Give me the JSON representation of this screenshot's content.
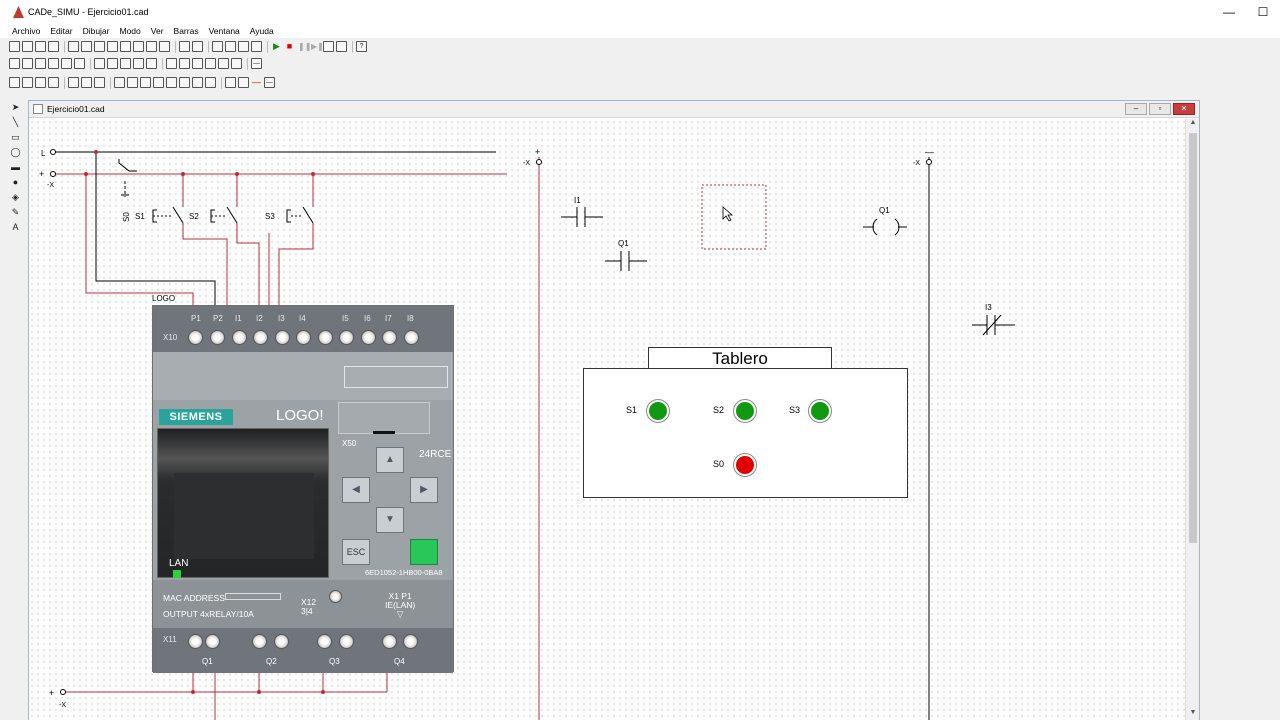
{
  "app": {
    "title": "CADe_SIMU - Ejercicio01.cad"
  },
  "window_controls": {
    "minimize": "—",
    "maximize": "☐"
  },
  "menu": [
    "Archivo",
    "Editar",
    "Dibujar",
    "Modo",
    "Ver",
    "Barras",
    "Ventana",
    "Ayuda"
  ],
  "document": {
    "title": "Ejercicio01.cad"
  },
  "schematic": {
    "rail_labels": {
      "l": "L",
      "plus": "+",
      "minus_x": "-X",
      "x_top": "-X",
      "plus_right": "+",
      "x_right": "-X",
      "minus_right": "—",
      "plus_bottom": "+",
      "x_bottom": "-X"
    },
    "switches": [
      "S0",
      "S1",
      "S2",
      "S3"
    ],
    "logo_label": "LOGO",
    "ladder": {
      "contact_i1": "I1",
      "contact_q1": "Q1",
      "coil_q1": "Q1",
      "contact_i3": "I3"
    }
  },
  "logo": {
    "terminals_top": [
      "P1",
      "P2",
      "I1",
      "I2",
      "I3",
      "I4",
      "I5",
      "I6",
      "I7",
      "I8"
    ],
    "x10": "X10",
    "brand": "SIEMENS",
    "model": "LOGO!",
    "x50": "X50",
    "variant": "24RCE",
    "lan": "LAN",
    "esc": "ESC",
    "part_number": "6ED1052-1HB00-0BA8",
    "mac": "MAC ADDRESS",
    "output": "OUTPUT 4xRELAY/10A",
    "x12": "X12",
    "x12_sub": "3|4",
    "x1p1": "X1 P1",
    "ielan": "IE(LAN)",
    "x11": "X11",
    "outputs": [
      "Q1",
      "Q2",
      "Q3",
      "Q4"
    ]
  },
  "tablero": {
    "title": "Tablero",
    "lamps": [
      {
        "label": "S1",
        "color": "#119a11"
      },
      {
        "label": "S2",
        "color": "#119a11"
      },
      {
        "label": "S3",
        "color": "#119a11"
      },
      {
        "label": "S0",
        "color": "#e00000"
      }
    ]
  },
  "colors": {
    "wire_red": "#c0293a",
    "wire_black": "#000000",
    "selection": "#c0293a"
  }
}
